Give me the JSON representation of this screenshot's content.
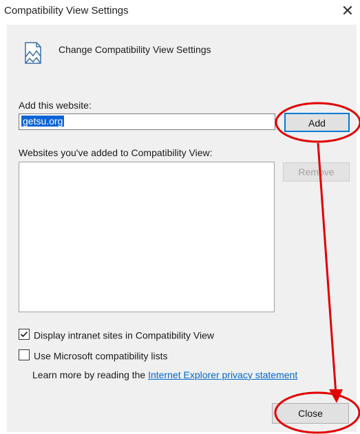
{
  "window": {
    "title": "Compatibility View Settings",
    "close_glyph": "✕"
  },
  "header": {
    "icon": "compatibility-view-icon",
    "text": "Change Compatibility View Settings"
  },
  "add_section": {
    "label": "Add this website:",
    "input_value": "getsu.org",
    "add_button": "Add"
  },
  "list_section": {
    "label": "Websites you've added to Compatibility View:",
    "items": [],
    "remove_button": "Remove"
  },
  "options": {
    "intranet": {
      "label": "Display intranet sites in Compatibility View",
      "checked": true
    },
    "ms_lists": {
      "label": "Use Microsoft compatibility lists",
      "checked": false
    }
  },
  "learn_more": {
    "prefix": "Learn more by reading the ",
    "link": "Internet Explorer privacy statement"
  },
  "footer": {
    "close_button": "Close"
  },
  "annotation": {
    "color": "#e00000"
  }
}
